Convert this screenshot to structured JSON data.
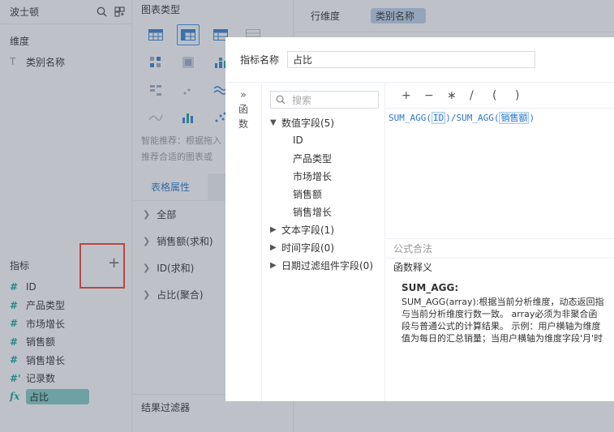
{
  "left": {
    "datasource": "波士顿",
    "dimension_title": "维度",
    "dimensions": [
      {
        "type": "T",
        "label": "类别名称"
      }
    ],
    "measure_title": "指标",
    "add_symbol": "+",
    "measures": [
      {
        "type": "#",
        "label": "ID"
      },
      {
        "type": "#",
        "label": "产品类型"
      },
      {
        "type": "#",
        "label": "市场增长"
      },
      {
        "type": "#",
        "label": "销售额"
      },
      {
        "type": "#",
        "label": "销售增长"
      },
      {
        "type": "#'",
        "label": "记录数"
      },
      {
        "type": "fx",
        "label": "占比"
      }
    ]
  },
  "middle": {
    "chart_type_title": "图表类型",
    "hint_line1": "智能推荐：根据拖入",
    "hint_line2": "推荐合适的图表或",
    "tab_active": "表格属性",
    "props": [
      "全部",
      "销售额(求和)",
      "ID(求和)",
      "占比(聚合)"
    ],
    "filter_title": "结果过滤器"
  },
  "right": {
    "row_dim_label": "行维度",
    "row_dim_value": "类别名称"
  },
  "dialog": {
    "name_label": "指标名称",
    "name_value": "占比",
    "side_expand": "»",
    "side_label_1": "函",
    "side_label_2": "数",
    "search_placeholder": "搜索",
    "tree": [
      {
        "label": "数值字段(5)",
        "expanded": true,
        "children": [
          "ID",
          "产品类型",
          "市场增长",
          "销售额",
          "销售增长"
        ]
      },
      {
        "label": "文本字段(1)",
        "expanded": false
      },
      {
        "label": "时间字段(0)",
        "expanded": false
      },
      {
        "label": "日期过滤组件字段(0)",
        "expanded": false
      }
    ],
    "operators": [
      "+",
      "−",
      "∗",
      "/",
      "(",
      ")"
    ],
    "formula": {
      "fn1": "SUM_AGG(",
      "arg1": "ID",
      "mid": ")/SUM_AGG(",
      "arg2": "销售额",
      "end": ")"
    },
    "valid_label": "公式合法",
    "explain_title": "函数释义",
    "explain_fname": "SUM_AGG:",
    "explain_lines": [
      "SUM_AGG(array):根据当前分析维度，动态返回指",
      "与当前分析维度行数一致。  array必须为非聚合函",
      "段与普通公式的计算结果。  示例：用户横轴为维度",
      "值为每日的汇总销量；当用户横轴为维度字段'月'时"
    ]
  }
}
